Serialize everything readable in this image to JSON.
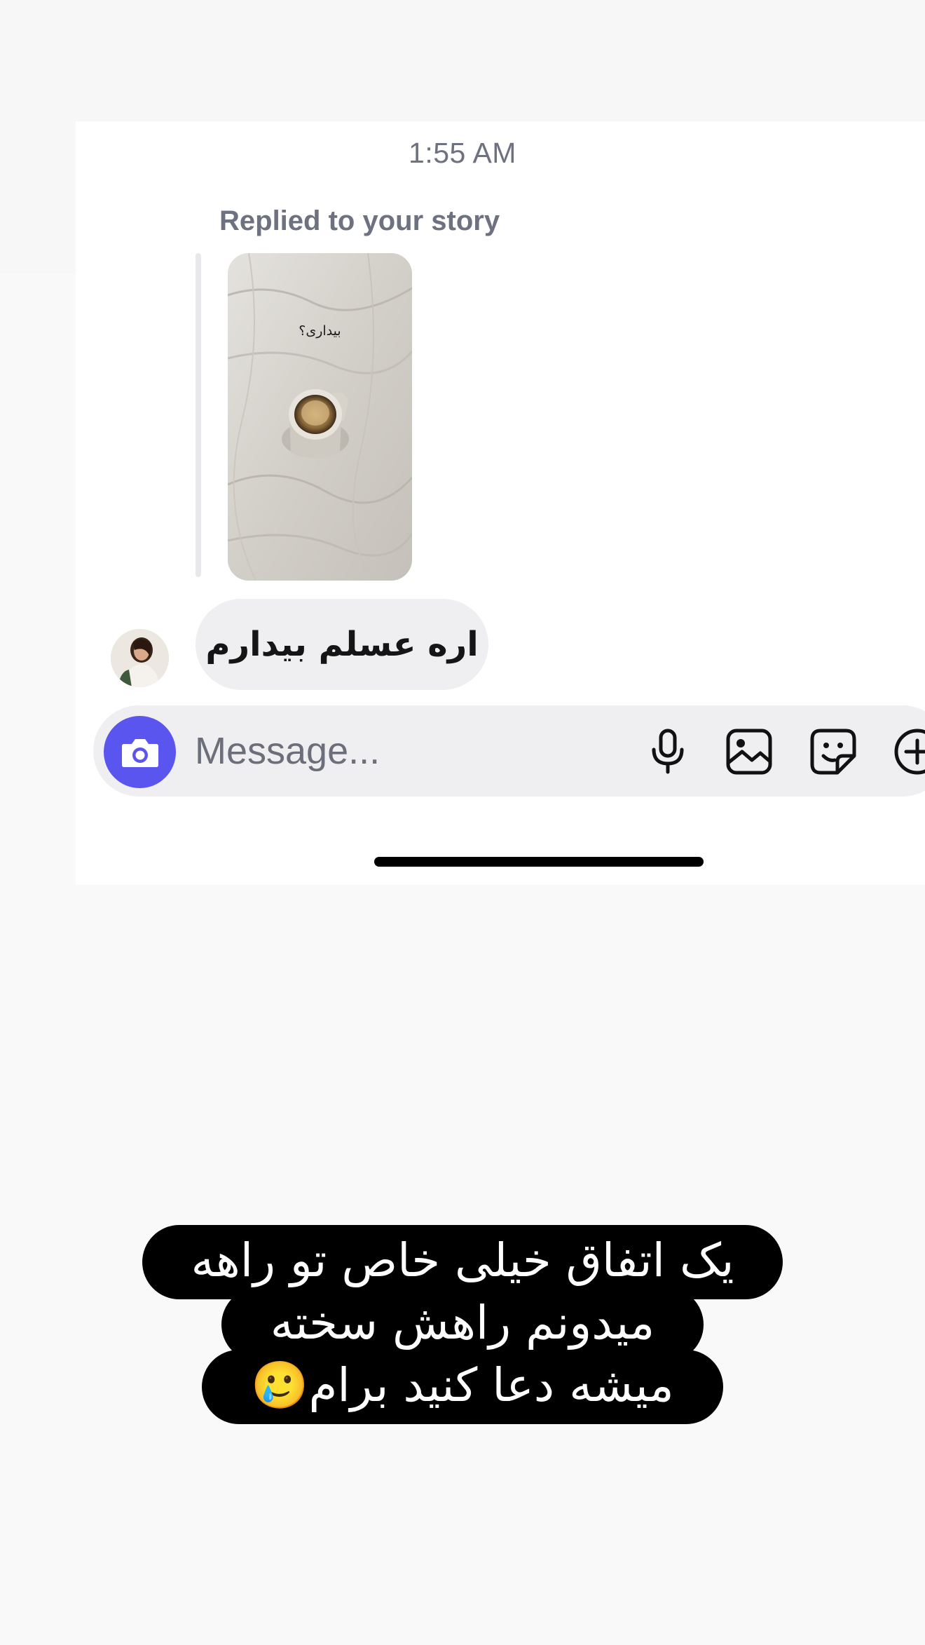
{
  "chat": {
    "timestamp": "1:55 AM",
    "reply_label": "Replied to your story",
    "story_caption": "بیداری؟",
    "message_text": "اره عسلم بیدارم"
  },
  "composer": {
    "placeholder": "Message...",
    "camera_icon": "camera-icon",
    "mic_icon": "microphone-icon",
    "gallery_icon": "image-icon",
    "sticker_icon": "sticker-icon",
    "add_icon": "plus-icon"
  },
  "overlay": {
    "lines": [
      "یک اتفاق خیلی خاص تو راهه",
      "میدونم راهش سخته",
      "میشه دعا کنید برام🥲"
    ]
  },
  "colors": {
    "accent": "#5b55f0",
    "bubble": "#efeff1",
    "muted_text": "#6e7180",
    "overlay_bg": "#000000"
  }
}
